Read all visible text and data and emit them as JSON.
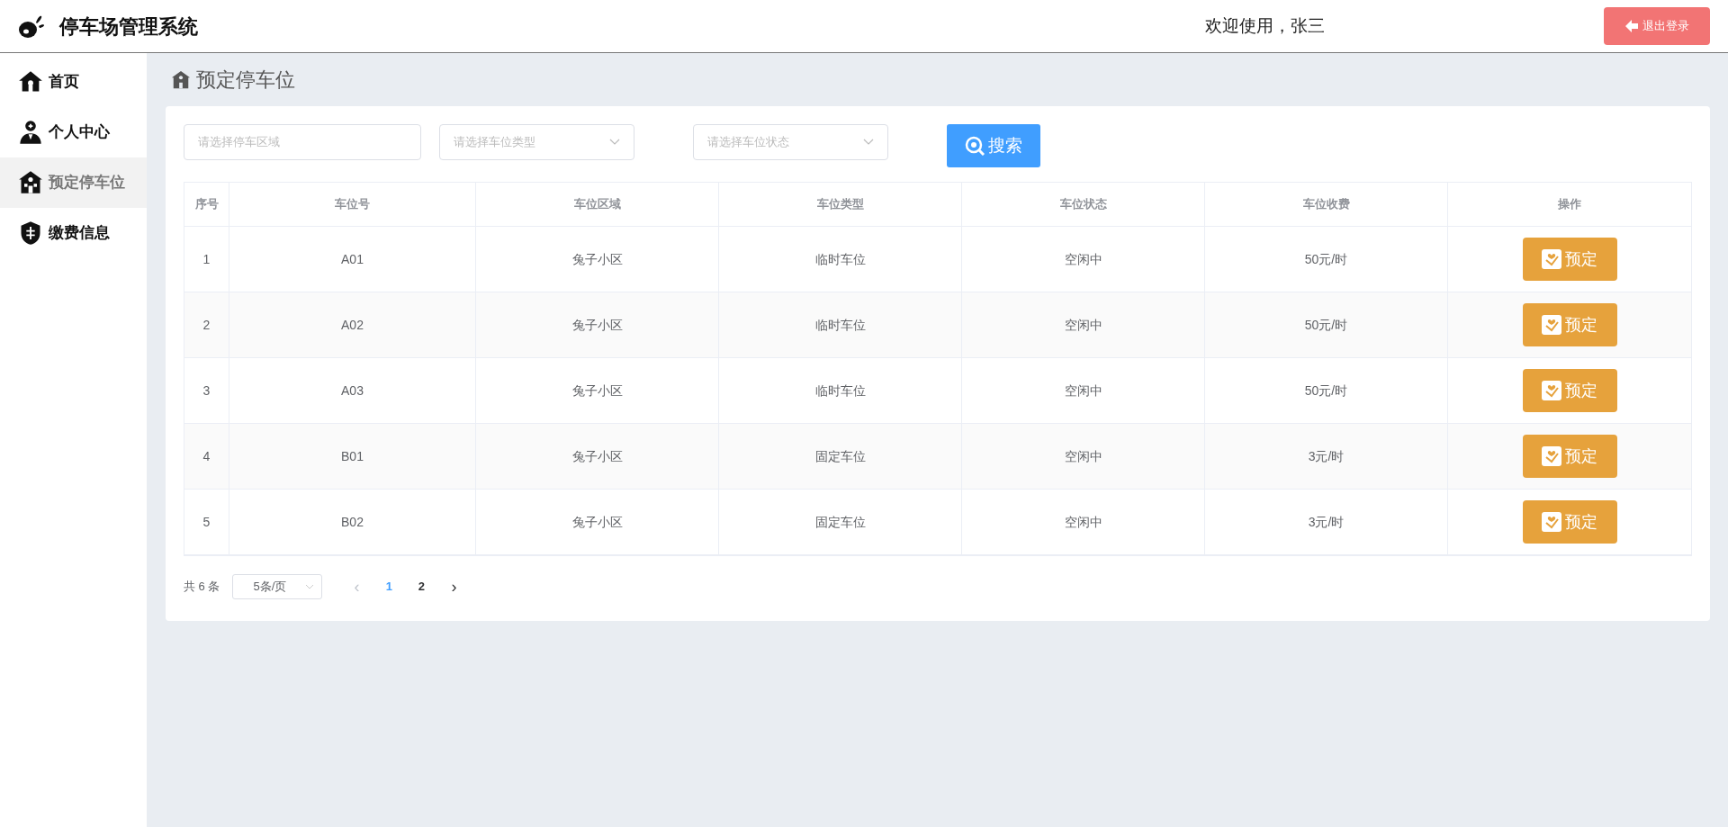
{
  "header": {
    "title": "停车场管理系统",
    "welcome": "欢迎使用，张三",
    "logout": "退出登录"
  },
  "sidebar": {
    "items": [
      {
        "label": "首页",
        "kind": "home",
        "selected": false
      },
      {
        "label": "个人中心",
        "kind": "user",
        "selected": false
      },
      {
        "label": "预定停车位",
        "kind": "building",
        "selected": true
      },
      {
        "label": "缴费信息",
        "kind": "shield",
        "selected": false
      }
    ]
  },
  "page_title": "预定停车位",
  "filters": [
    {
      "placeholder": "请选择停车区域",
      "kind": "input"
    },
    {
      "placeholder": "请选择车位类型",
      "kind": "select"
    },
    {
      "placeholder": "请选择车位状态",
      "kind": "select"
    }
  ],
  "search_button": "搜索",
  "table": {
    "columns": [
      "序号",
      "车位号",
      "车位区域",
      "车位类型",
      "车位状态",
      "车位收费",
      "操作"
    ],
    "rows": [
      {
        "cells": [
          "1",
          "A01",
          "兔子小区",
          "临时车位",
          "空闲中",
          "50元/时"
        ],
        "action": "预定"
      },
      {
        "cells": [
          "2",
          "A02",
          "兔子小区",
          "临时车位",
          "空闲中",
          "50元/时"
        ],
        "action": "预定"
      },
      {
        "cells": [
          "3",
          "A03",
          "兔子小区",
          "临时车位",
          "空闲中",
          "50元/时"
        ],
        "action": "预定"
      },
      {
        "cells": [
          "4",
          "B01",
          "兔子小区",
          "固定车位",
          "空闲中",
          "3元/时"
        ],
        "action": "预定"
      },
      {
        "cells": [
          "5",
          "B02",
          "兔子小区",
          "固定车位",
          "空闲中",
          "3元/时"
        ],
        "action": "预定"
      }
    ]
  },
  "pagination": {
    "total": "共 6 条",
    "page_size": "5条/页",
    "prev": "‹",
    "pages": [
      {
        "label": "1",
        "selected": true
      },
      {
        "label": "2",
        "selected": false
      }
    ],
    "next": "›"
  }
}
